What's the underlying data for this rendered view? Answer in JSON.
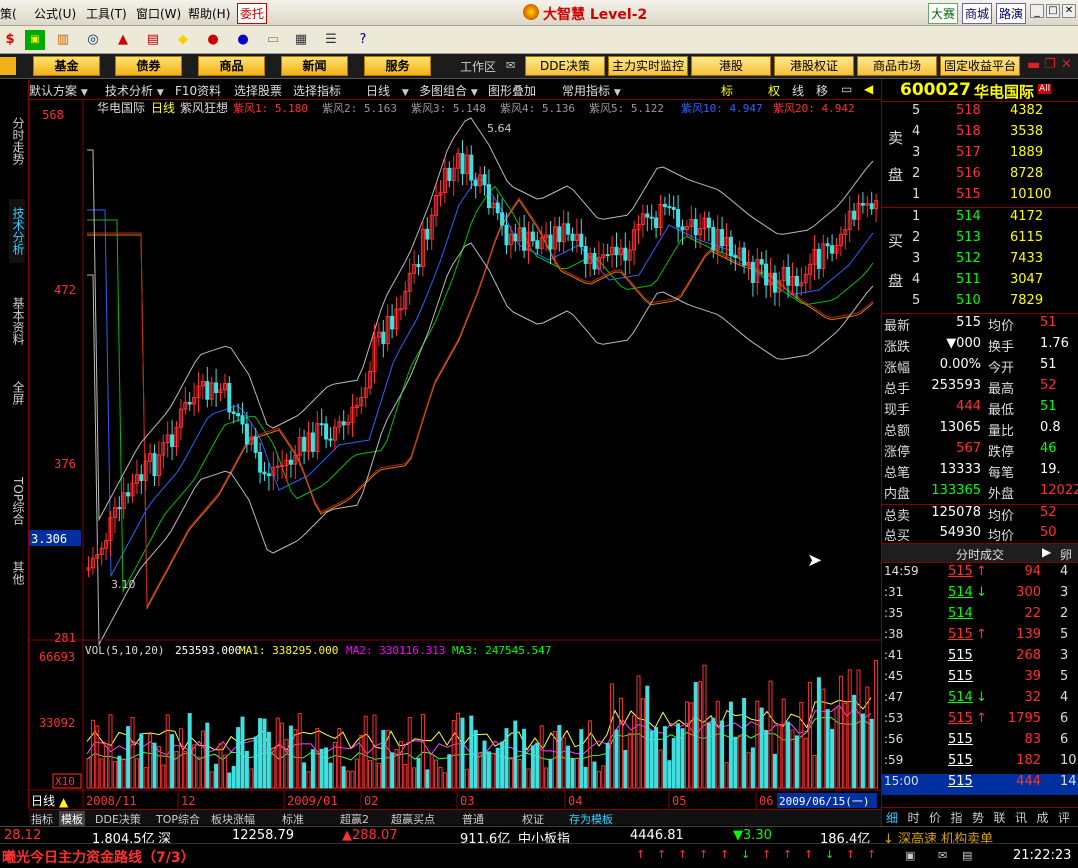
{
  "menubar": {
    "items": [
      "策(",
      "公式(U)",
      "工具(T)",
      "窗口(W)",
      "帮助(H)"
    ],
    "entrust": "委托",
    "app_title": "大智慧 Level-2",
    "right_tabs": [
      "大赛",
      "商城",
      "路演"
    ]
  },
  "navbar": {
    "left": [
      "基金",
      "债券",
      "商品",
      "新闻",
      "服务"
    ],
    "workzone": "工作区",
    "right": [
      "DDE决策",
      "主力实时监控",
      "港股",
      "港股权证",
      "商品市场",
      "固定收益平台"
    ]
  },
  "left_tabs": [
    "分时走势",
    "技术分析",
    "基本资料",
    "全屏",
    "TOP综合",
    "其他"
  ],
  "toolbar2": {
    "items": [
      "默认方案",
      "技术分析",
      "F10资料",
      "选择股票",
      "选择指标",
      "日线",
      "多图组合",
      "图形叠加",
      "常用指标"
    ],
    "icons": [
      "标",
      "权",
      "线",
      "移"
    ]
  },
  "chart_header": {
    "stock": "华电国际",
    "period": "日线",
    "indicator": "紫风狂想",
    "params": [
      {
        "label": "紫风1:",
        "value": "5.180"
      },
      {
        "label": "紫风2:",
        "value": "5.163"
      },
      {
        "label": "紫风3:",
        "value": "5.148"
      },
      {
        "label": "紫风4:",
        "value": "5.136"
      },
      {
        "label": "紫风5:",
        "value": "5.122"
      },
      {
        "label": "紫风10:",
        "value": "4.947"
      },
      {
        "label": "紫风20:",
        "value": "4.942"
      }
    ]
  },
  "price_axis": {
    "ticks": [
      "568",
      "472",
      "376",
      "281"
    ],
    "current": "3.306",
    "high_label": "5.64",
    "low_label": "3.10"
  },
  "volume_header": {
    "label": "VOL(5,10,20)",
    "value": "253593.000",
    "ma1": "MA1: 338295.000",
    "ma2": "MA2: 330116.313",
    "ma3": "MA3: 247545.547"
  },
  "volume_axis": {
    "ticks": [
      "66693",
      "33092"
    ],
    "unit": "X10"
  },
  "time_axis": {
    "period": "日线",
    "labels": [
      "2008/11",
      "12",
      "2009/01",
      "02",
      "03",
      "04",
      "05",
      "06"
    ],
    "cursor_date": "2009/06/15(一)"
  },
  "bottom_tabs": [
    "指标",
    "模板",
    "DDE决策",
    "TOP综合",
    "板块涨幅",
    "标准",
    "超赢2",
    "超赢买点",
    "普通",
    "权证",
    "存为模板"
  ],
  "quote": {
    "code": "600027",
    "name": "华电国际",
    "sell_label": [
      "卖",
      "盘"
    ],
    "buy_label": [
      "买",
      "盘"
    ],
    "asks": [
      {
        "lvl": "5",
        "price": "518",
        "vol": "4382"
      },
      {
        "lvl": "4",
        "price": "518",
        "vol": "3538"
      },
      {
        "lvl": "3",
        "price": "517",
        "vol": "1889"
      },
      {
        "lvl": "2",
        "price": "516",
        "vol": "8728"
      },
      {
        "lvl": "1",
        "price": "515",
        "vol": "10100"
      }
    ],
    "bids": [
      {
        "lvl": "1",
        "price": "514",
        "vol": "4172"
      },
      {
        "lvl": "2",
        "price": "513",
        "vol": "6115"
      },
      {
        "lvl": "3",
        "price": "512",
        "vol": "7433"
      },
      {
        "lvl": "4",
        "price": "511",
        "vol": "3047"
      },
      {
        "lvl": "5",
        "price": "510",
        "vol": "7829"
      }
    ],
    "stats": [
      {
        "k1": "最新",
        "v1": "515",
        "c1": "#fff",
        "k2": "均价",
        "v2": "51",
        "c2": "#ff3030"
      },
      {
        "k1": "涨跌",
        "v1": "▼000",
        "c1": "#fff",
        "k2": "换手",
        "v2": "1.76",
        "c2": "#fff"
      },
      {
        "k1": "涨幅",
        "v1": "0.00%",
        "c1": "#fff",
        "k2": "今开",
        "v2": "51",
        "c2": "#fff"
      },
      {
        "k1": "总手",
        "v1": "253593",
        "c1": "#fff",
        "k2": "最高",
        "v2": "52",
        "c2": "#ff3030"
      },
      {
        "k1": "现手",
        "v1": "444",
        "c1": "#ff3030",
        "k2": "最低",
        "v2": "51",
        "c2": "#00ff00"
      },
      {
        "k1": "总额",
        "v1": "13065",
        "c1": "#fff",
        "k2": "量比",
        "v2": "0.8",
        "c2": "#fff"
      },
      {
        "k1": "涨停",
        "v1": "567",
        "c1": "#ff3030",
        "k2": "跌停",
        "v2": "46",
        "c2": "#00ff00"
      },
      {
        "k1": "总笔",
        "v1": "13333",
        "c1": "#fff",
        "k2": "每笔",
        "v2": "19.",
        "c2": "#fff"
      },
      {
        "k1": "内盘",
        "v1": "133365",
        "c1": "#00ff00",
        "k2": "外盘",
        "v2": "12022",
        "c2": "#ff3030"
      },
      {
        "k1": "总卖",
        "v1": "125078",
        "c1": "#fff",
        "k2": "均价",
        "v2": "52",
        "c2": "#ff3030"
      },
      {
        "k1": "总买",
        "v1": "54930",
        "c1": "#fff",
        "k2": "均价",
        "v2": "50",
        "c2": "#ff3030"
      }
    ],
    "ticks_title": "分时成交",
    "ticks": [
      {
        "t": "14:59",
        "p": "515",
        "a": "↑",
        "ac": "#ff3030",
        "v": "94",
        "vc": "#ff3030",
        "n": "4"
      },
      {
        "t": ":31",
        "p": "514",
        "a": "↓",
        "ac": "#00ff00",
        "v": "300",
        "vc": "#ff3030",
        "n": "3"
      },
      {
        "t": ":35",
        "p": "514",
        "a": "",
        "ac": "#00ff00",
        "v": "22",
        "vc": "#ff3030",
        "n": "2"
      },
      {
        "t": ":38",
        "p": "515",
        "a": "↑",
        "ac": "#ff3030",
        "v": "139",
        "vc": "#ff3030",
        "n": "5"
      },
      {
        "t": ":41",
        "p": "515",
        "a": "",
        "ac": "#fff",
        "v": "268",
        "vc": "#ff3030",
        "n": "3"
      },
      {
        "t": ":45",
        "p": "515",
        "a": "",
        "ac": "#fff",
        "v": "39",
        "vc": "#ff3030",
        "n": "5"
      },
      {
        "t": ":47",
        "p": "514",
        "a": "↓",
        "ac": "#00ff00",
        "v": "32",
        "vc": "#ff3030",
        "n": "4"
      },
      {
        "t": ":53",
        "p": "515",
        "a": "↑",
        "ac": "#ff3030",
        "v": "1795",
        "vc": "#ff3030",
        "n": "6"
      },
      {
        "t": ":56",
        "p": "515",
        "a": "",
        "ac": "#fff",
        "v": "83",
        "vc": "#ff3030",
        "n": "6"
      },
      {
        "t": ":59",
        "p": "515",
        "a": "",
        "ac": "#fff",
        "v": "182",
        "vc": "#ff3030",
        "n": "10"
      },
      {
        "t": "15:00",
        "p": "515",
        "a": "",
        "ac": "#fff",
        "v": "444",
        "vc": "#ff3030",
        "n": "14"
      }
    ],
    "bottom_tabs": [
      "细",
      "时",
      "价",
      "指",
      "势",
      "联",
      "讯",
      "成",
      "评"
    ]
  },
  "status": {
    "items": [
      {
        "v": "28.12",
        "c": "#ff3030"
      },
      {
        "v": "1,804.5亿",
        "c": "#fff"
      },
      {
        "v": "深",
        "c": "#fff"
      },
      {
        "v": "12258.79",
        "c": "#fff"
      },
      {
        "v": "▲288.07",
        "c": "#ff3030"
      },
      {
        "v": "911.6亿",
        "c": "#fff"
      },
      {
        "v": "中小板指",
        "c": "#fff"
      },
      {
        "v": "4446.81",
        "c": "#fff"
      },
      {
        "v": "▼3.30",
        "c": "#00ff00"
      },
      {
        "v": "186.4亿",
        "c": "#fff"
      },
      {
        "v": "↓ 深高速 机构卖单",
        "c": "#d4a000"
      }
    ],
    "ticker": "曦光今日主力资金路线（7/3）",
    "time": "21:22:23"
  }
}
